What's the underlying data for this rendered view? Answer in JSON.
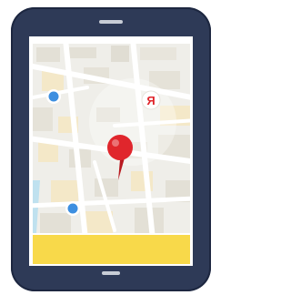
{
  "map": {
    "badge_text": "Я",
    "pin_color": "#e0262c",
    "location_dot_color": "#3d8fe0",
    "bottom_bar_color": "#f8d94a",
    "device_color": "#2e3a57"
  }
}
